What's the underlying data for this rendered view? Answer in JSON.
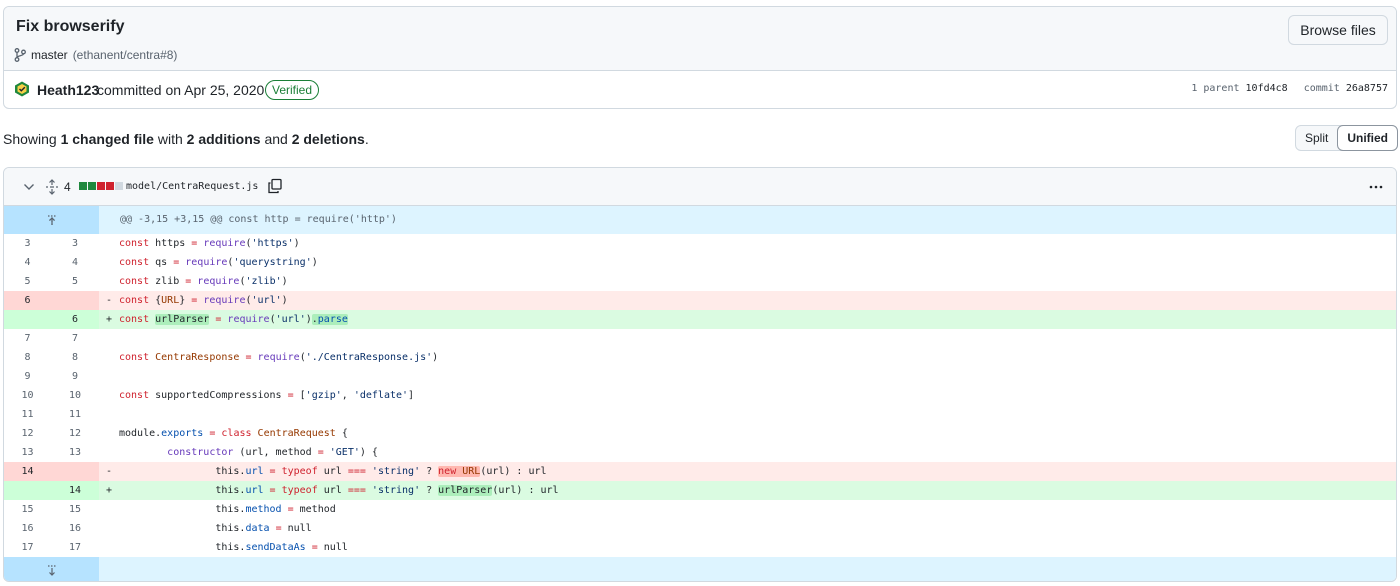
{
  "commit": {
    "title": "Fix browserify",
    "branch": "master",
    "branch_ref": "(ethanent/centra#8)",
    "browse_label": "Browse files",
    "author": "Heath123",
    "committed_text": "committed on Apr 25, 2020",
    "verified_label": "Verified",
    "parent_label": "1 parent",
    "parent_sha": "10fd4c8",
    "commit_label": "commit",
    "commit_sha": "26a8757"
  },
  "summary": {
    "prefix": "Showing",
    "changed": "1 changed file",
    "with": "with",
    "additions": "2 additions",
    "and": "and",
    "deletions": "2 deletions",
    "suffix": "."
  },
  "view_toggle": {
    "split": "Split",
    "unified": "Unified",
    "selected": "Unified"
  },
  "file": {
    "change_count": "4",
    "diffstat": [
      "add",
      "add",
      "del",
      "del",
      "neutral"
    ],
    "path": "model/CentraRequest.js",
    "hunk_header": "@@ -3,15 +3,15 @@ const http = require('http')",
    "colors": {
      "add": "#1f883d",
      "del": "#cf222e",
      "neutral": "#d1d9e0"
    }
  },
  "lines": [
    {
      "type": "ctx",
      "old": "3",
      "new": "3",
      "code": "const https = require('https')"
    },
    {
      "type": "ctx",
      "old": "4",
      "new": "4",
      "code": "const qs = require('querystring')"
    },
    {
      "type": "ctx",
      "old": "5",
      "new": "5",
      "code": "const zlib = require('zlib')"
    },
    {
      "type": "del",
      "old": "6",
      "new": "",
      "code": "const {URL} = require('url')"
    },
    {
      "type": "add",
      "old": "",
      "new": "6",
      "code": "const urlParser = require('url').parse"
    },
    {
      "type": "ctx",
      "old": "7",
      "new": "7",
      "code": ""
    },
    {
      "type": "ctx",
      "old": "8",
      "new": "8",
      "code": "const CentraResponse = require('./CentraResponse.js')"
    },
    {
      "type": "ctx",
      "old": "9",
      "new": "9",
      "code": ""
    },
    {
      "type": "ctx",
      "old": "10",
      "new": "10",
      "code": "const supportedCompressions = ['gzip', 'deflate']"
    },
    {
      "type": "ctx",
      "old": "11",
      "new": "11",
      "code": ""
    },
    {
      "type": "ctx",
      "old": "12",
      "new": "12",
      "code": "module.exports = class CentraRequest {"
    },
    {
      "type": "ctx",
      "old": "13",
      "new": "13",
      "code": "\tconstructor (url, method = 'GET') {"
    },
    {
      "type": "del",
      "old": "14",
      "new": "",
      "code": "\t\tthis.url = typeof url === 'string' ? new URL(url) : url"
    },
    {
      "type": "add",
      "old": "",
      "new": "14",
      "code": "\t\tthis.url = typeof url === 'string' ? urlParser(url) : url"
    },
    {
      "type": "ctx",
      "old": "15",
      "new": "15",
      "code": "\t\tthis.method = method"
    },
    {
      "type": "ctx",
      "old": "16",
      "new": "16",
      "code": "\t\tthis.data = null"
    },
    {
      "type": "ctx",
      "old": "17",
      "new": "17",
      "code": "\t\tthis.sendDataAs = null"
    }
  ]
}
